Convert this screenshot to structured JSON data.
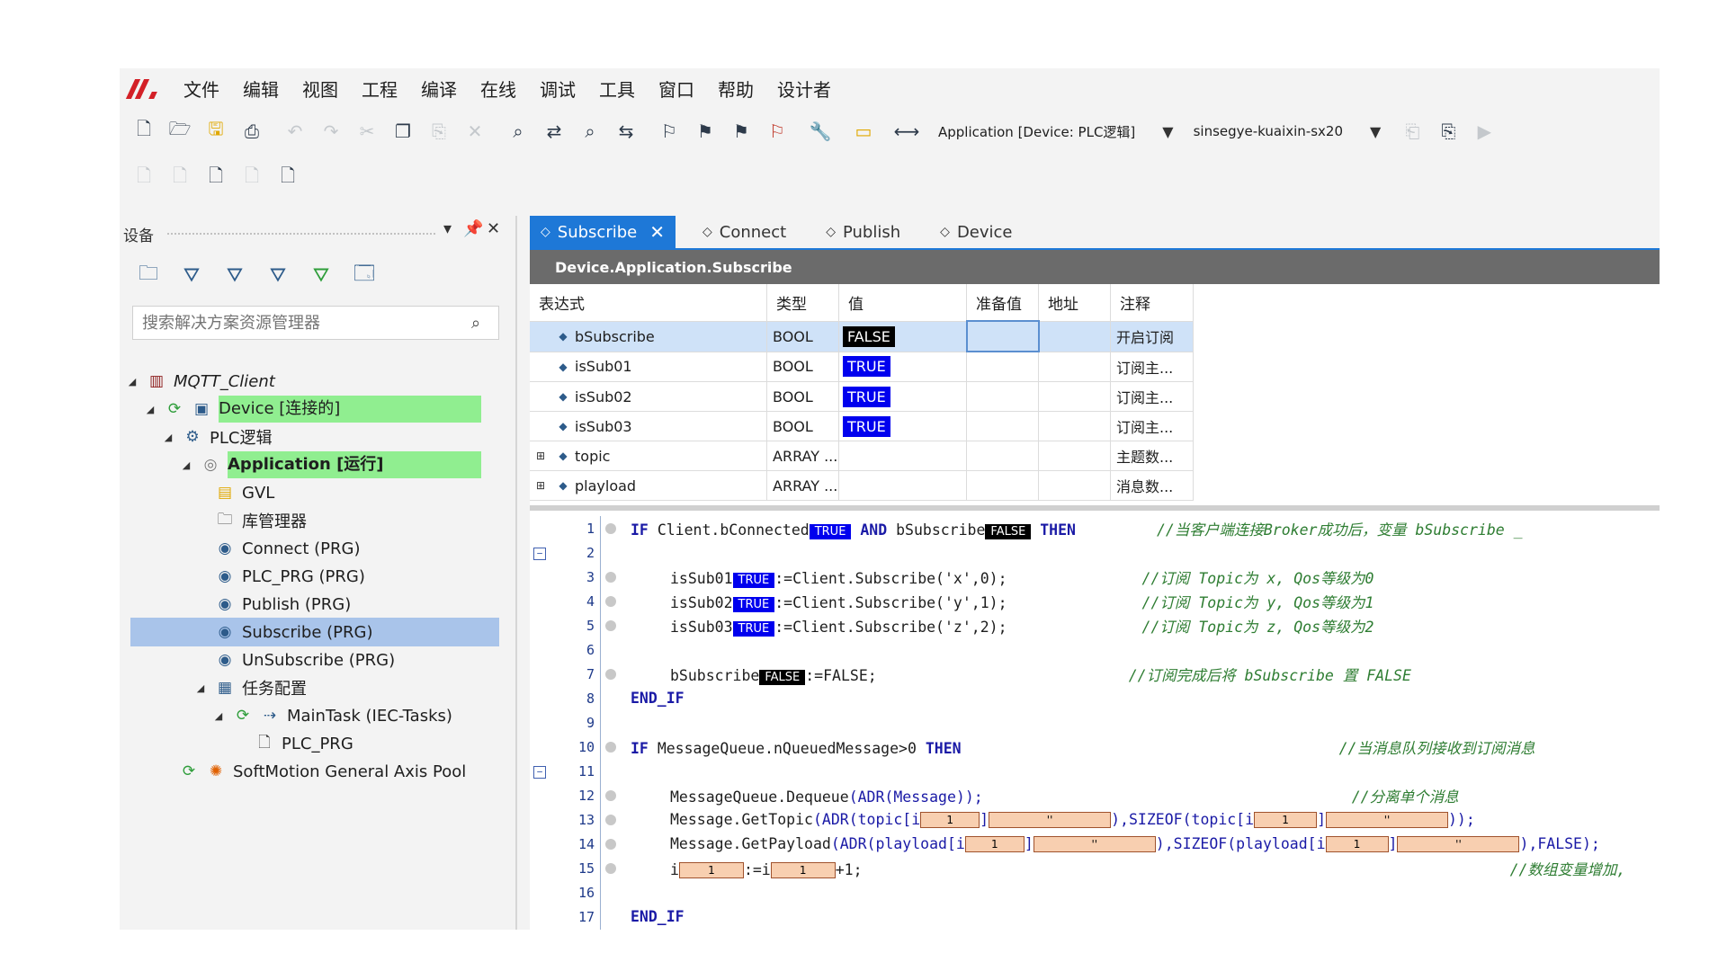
{
  "menu": [
    "文件",
    "编辑",
    "视图",
    "工程",
    "编译",
    "在线",
    "调试",
    "工具",
    "窗口",
    "帮助",
    "设计者"
  ],
  "toolbar": {
    "app_combo": "Application [Device: PLC逻辑]",
    "device_combo": "sinsegye-kuaixin-sx20"
  },
  "left": {
    "title": "设备",
    "search_placeholder": "搜索解决方案资源管理器",
    "tree": {
      "project": "MQTT_Client",
      "device": "Device [连接的]",
      "plc": "PLC逻辑",
      "application": "Application [运行]",
      "gvl": "GVL",
      "lib": "库管理器",
      "connect": "Connect (PRG)",
      "plc_prg": "PLC_PRG (PRG)",
      "publish": "Publish (PRG)",
      "subscribe": "Subscribe (PRG)",
      "unsubscribe": "UnSubscribe (PRG)",
      "taskcfg": "任务配置",
      "maintask": "MainTask (IEC-Tasks)",
      "plc_prg_task": "PLC_PRG",
      "softmotion": "SoftMotion General Axis Pool"
    }
  },
  "tabs": [
    "Subscribe",
    "Connect",
    "Publish",
    "Device"
  ],
  "path": "Device.Application.Subscribe",
  "watch": {
    "headers": [
      "表达式",
      "类型",
      "值",
      "准备值",
      "地址",
      "注释"
    ],
    "rows": [
      {
        "expr": "bSubscribe",
        "type": "BOOL",
        "value": "FALSE",
        "comment": "开启订阅"
      },
      {
        "expr": "isSub01",
        "type": "BOOL",
        "value": "TRUE",
        "comment": "订阅主..."
      },
      {
        "expr": "isSub02",
        "type": "BOOL",
        "value": "TRUE",
        "comment": "订阅主..."
      },
      {
        "expr": "isSub03",
        "type": "BOOL",
        "value": "TRUE",
        "comment": "订阅主..."
      },
      {
        "expr": "topic",
        "type": "ARRAY ...",
        "value": "",
        "comment": "主题数..."
      },
      {
        "expr": "playload",
        "type": "ARRAY ...",
        "value": "",
        "comment": "消息数..."
      }
    ]
  },
  "code": {
    "l1": {
      "a": "IF ",
      "b": "Client.bConnected",
      "v": "TRUE",
      "c": " AND ",
      "d": "bSubscribe",
      "v2": "FALSE",
      "e": " THEN",
      "cm": "//当客户端连接Broker成功后，变量 bSubscribe _"
    },
    "l3": {
      "a": "isSub01",
      "v": "TRUE",
      "b": ":=Client.Subscribe('x',0);",
      "cm": "//订阅 Topic为 x, Qos等级为0"
    },
    "l4": {
      "a": "isSub02",
      "v": "TRUE",
      "b": ":=Client.Subscribe('y',1);",
      "cm": "//订阅 Topic为 y, Qos等级为1"
    },
    "l5": {
      "a": "isSub03",
      "v": "TRUE",
      "b": ":=Client.Subscribe('z',2);",
      "cm": "//订阅 Topic为 z, Qos等级为2"
    },
    "l7": {
      "a": "bSubscribe",
      "v": "FALSE",
      "b": ":=FALSE;",
      "cm": "//订阅完成后将 bSubscribe 置 FALSE"
    },
    "l8": "END_IF",
    "l10": {
      "a": "IF ",
      "b": "MessageQueue.nQueuedMessage>0",
      "c": " THEN",
      "cm": "//当消息队列接收到订阅消息"
    },
    "l12": {
      "a": "MessageQueue.Dequeue",
      "b": "(ADR(Message));",
      "cm": "//分离单个消息"
    },
    "l13": {
      "a": "Message.GetTopic",
      "b": "(ADR(topic[i",
      "m1": "1",
      "b2": "]",
      "m2": "''",
      "b3": "),SIZEOF(topic[i",
      "m3": "1",
      "b4": "]",
      "m4": "''",
      "b5": "));"
    },
    "l14": {
      "a": "Message.GetPayload",
      "b": "(ADR(playload[i",
      "m1": "1",
      "b2": "]",
      "m2": "''",
      "b3": "),SIZEOF(playload[i",
      "m3": "1",
      "b4": "]",
      "m4": "''",
      "b5": "),FALSE);"
    },
    "l15": {
      "a": "i",
      "m1": "1",
      "b": ":=i",
      "m2": "1",
      "c": "+1;",
      "cm": "//数组变量增加,"
    },
    "l17": "END_IF",
    "line_numbers": [
      "1",
      "2",
      "3",
      "4",
      "5",
      "6",
      "7",
      "8",
      "9",
      "10",
      "11",
      "12",
      "13",
      "14",
      "15",
      "16",
      "17"
    ]
  }
}
